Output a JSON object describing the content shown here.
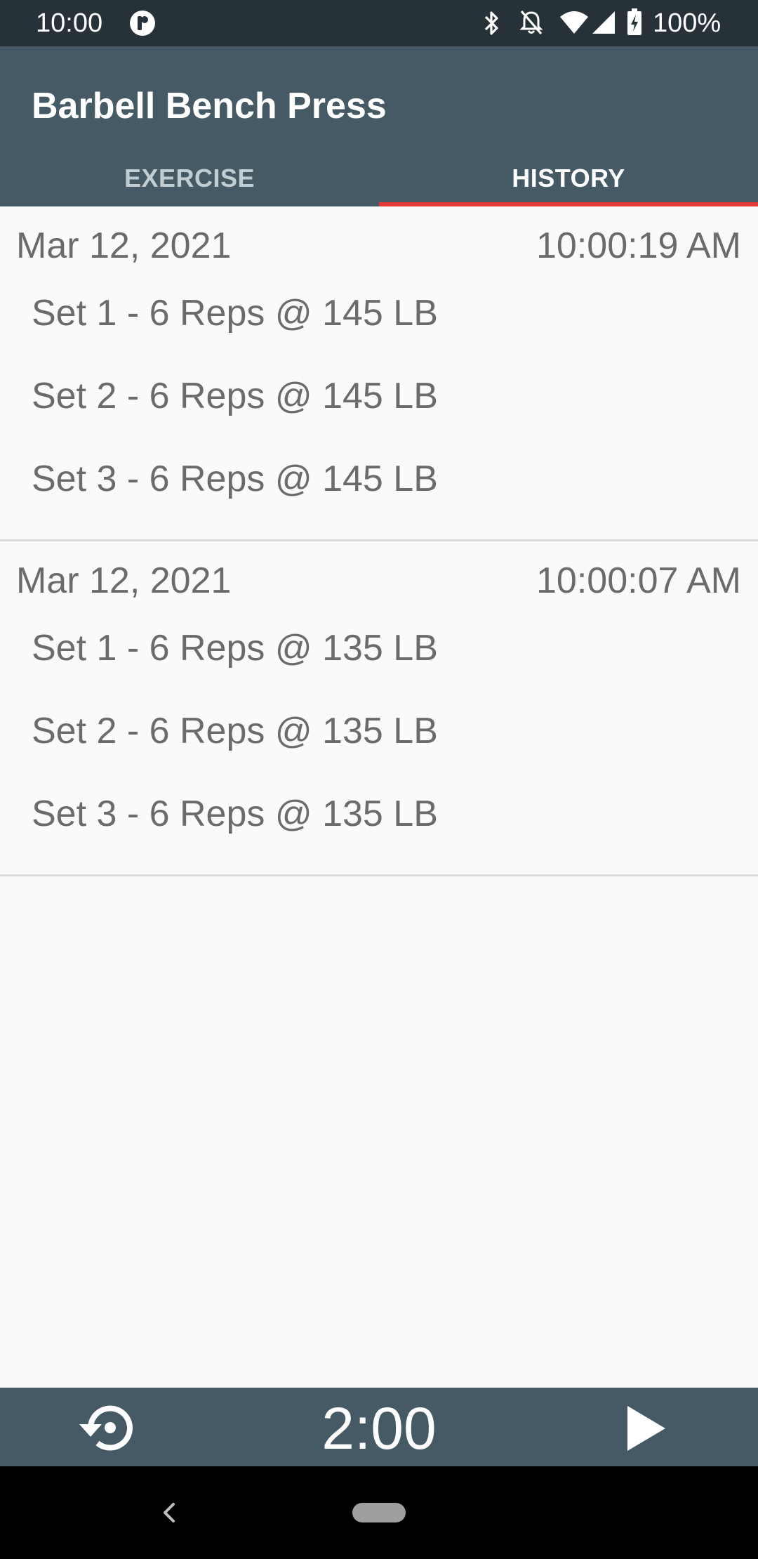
{
  "status_bar": {
    "time": "10:00",
    "battery_text": "100%",
    "icons": [
      "app-notification-icon",
      "bluetooth-icon",
      "notifications-off-icon",
      "wifi-icon",
      "cell-signal-icon",
      "battery-charging-icon"
    ]
  },
  "app_bar": {
    "title": "Barbell Bench Press",
    "tabs": [
      {
        "label": "EXERCISE",
        "selected": false
      },
      {
        "label": "HISTORY",
        "selected": true
      }
    ],
    "accent_color": "#e53935",
    "background_color": "#455a64"
  },
  "history": {
    "sessions": [
      {
        "date": "Mar 12, 2021",
        "time": "10:00:19 AM",
        "sets": [
          "Set 1 - 6 Reps @ 145 LB",
          "Set 2 - 6 Reps @ 145 LB",
          "Set 3 - 6 Reps @ 145 LB"
        ]
      },
      {
        "date": "Mar 12, 2021",
        "time": "10:00:07 AM",
        "sets": [
          "Set 1 - 6 Reps @ 135 LB",
          "Set 2 - 6 Reps @ 135 LB",
          "Set 3 - 6 Reps @ 135 LB"
        ]
      }
    ]
  },
  "timer": {
    "display": "2:00",
    "reset_icon": "restart-icon",
    "play_icon": "play-icon"
  },
  "nav_bar": {
    "back_icon": "back-chevron-icon",
    "home_icon": "home-pill-icon"
  }
}
